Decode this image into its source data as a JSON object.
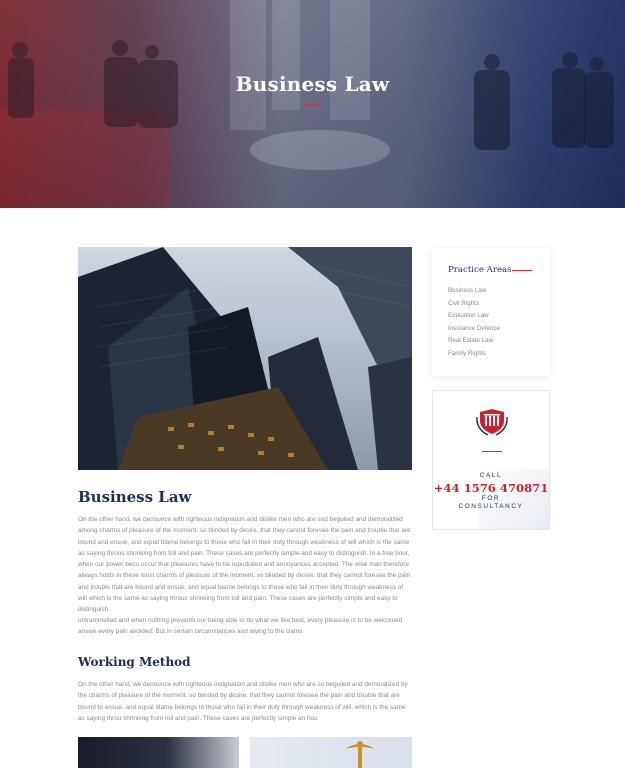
{
  "hero": {
    "title": "Business Law"
  },
  "article": {
    "title": "Business Law",
    "para1": "On the other hand, we denounce with righteous indignation and dislike men who are snd beguiled and demoralized among charms of pleasure of the moment, so blinded by desire, that they cannot foresee the pain and trouble that are bound and ensue, and equal blame belongs to those who fail in their duty through weakness of will which is the same as saying throus shrinking from toil and pain. These cases are perfectly simple and easy to distinguish. In a free hour, when our power beco occur that pleasures have to be repudiated and annoyances accepted. The wise man therefore always holds in these must charms of pleasure of the moment, so blinded by desire, that they cannot foresee the pain and trouble that are bound and ensue, and equal blame belongs to those who fail in their duty through weakness of will which is the same as saying throus shrinking from toil and pain. These cases are perfectly simple and easy to distinguish.",
    "para2": "untrammelled and when nothing prevents our being able to do what we like best, every pleasure is to be welcomed answe every pain avoided. But in certain circumstances and owing to the clams",
    "subtitle": "Working Method",
    "para3": "On the other hand, we denounce with righteous indignation and dislike men who are so beguiled and demoralized by the charms of pleasure of the moment, so blinded by desire, that they cannot foresee the pain and trouble that are bound to ensue, and equal blame belongs to those who fail in their duty through weakness of will, which is the same as saying throu shrinking from toil and pain. These cases are perfectly simple an hou"
  },
  "sidebar": {
    "title": "Practice Areas",
    "items": [
      {
        "label": "Business Law"
      },
      {
        "label": "Civil Rights"
      },
      {
        "label": "Education Law"
      },
      {
        "label": "Insurance Defence"
      },
      {
        "label": "Real Estate Law"
      },
      {
        "label": "Family Rights"
      }
    ]
  },
  "cta": {
    "call": "CALL",
    "phone": "+44 1576 470871",
    "for_line1": "FOR",
    "for_line2": "CONSULTANCY",
    "emblem_icon": "shield-columns-icon"
  },
  "colors": {
    "navy": "#1f2c5e",
    "accent_red": "#d0343a",
    "phone_red": "#c9242b"
  }
}
